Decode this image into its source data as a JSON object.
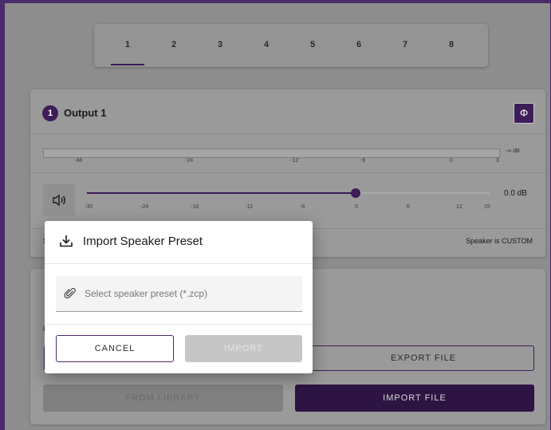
{
  "tabs": [
    "1",
    "2",
    "3",
    "4",
    "5",
    "6",
    "7",
    "8"
  ],
  "active_tab": "1",
  "output": {
    "number": "1",
    "title": "Output 1",
    "phase_symbol": "Φ",
    "meter_labels": [
      "-48",
      "-24",
      "-12",
      "-6",
      "0",
      "3"
    ],
    "meter_db": "-∞ dB",
    "speaker_icon": "speaker-icon",
    "slider_labels": [
      "-30",
      "-24",
      "-18",
      "-12",
      "-6",
      "0",
      "6",
      "12",
      "15"
    ],
    "gain_value": "0.0 dB",
    "gain_db": 0.0,
    "footer_left": "S",
    "footer_right": "Speaker is CUSTOM"
  },
  "lower_card": {
    "side_letter": "I",
    "export_label": "EXPORT FILE",
    "library_label": "FROM LIBRARY",
    "import_file_label": "IMPORT FILE"
  },
  "dialog": {
    "title": "Import Speaker Preset",
    "title_icon": "download-icon",
    "file_icon": "paperclip-icon",
    "placeholder": "Select speaker preset (*.zcp)",
    "cancel_label": "CANCEL",
    "import_label": "IMPORT"
  },
  "colors": {
    "accent": "#3d1d58",
    "overlay": "#8d8d8d",
    "dialog_bg": "#ffffff"
  }
}
